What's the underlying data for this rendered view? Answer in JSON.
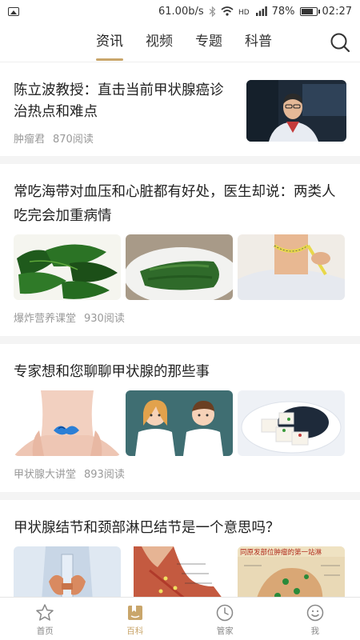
{
  "status_bar": {
    "speed": "61.00b/s",
    "battery": "78%",
    "battery_level": 0.78,
    "time": "02:27"
  },
  "top_tabs": [
    {
      "label": "资讯",
      "active": true
    },
    {
      "label": "视频",
      "active": false
    },
    {
      "label": "专题",
      "active": false
    },
    {
      "label": "科普",
      "active": false
    }
  ],
  "articles": [
    {
      "title": "陈立波教授：直击当前甲状腺癌诊治热点和难点",
      "source": "肿瘤君",
      "reads": "870阅读"
    },
    {
      "title": "常吃海带对血压和心脏都有好处，医生却说：两类人吃完会加重病情",
      "source": "爆炸营养课堂",
      "reads": "930阅读"
    },
    {
      "title": "专家想和您聊聊甲状腺的那些事",
      "source": "甲状腺大讲堂",
      "reads": "893阅读"
    },
    {
      "title": "甲状腺结节和颈部淋巴结节是一个意思吗？",
      "thumb3_text": "同原发部位肿瘤的第一站淋"
    }
  ],
  "bottom_nav": [
    {
      "label": "首页",
      "icon": "star-icon",
      "active": false
    },
    {
      "label": "百科",
      "icon": "book-icon",
      "active": true
    },
    {
      "label": "管家",
      "icon": "clock-icon",
      "active": false
    },
    {
      "label": "我",
      "icon": "smile-icon",
      "active": false
    }
  ],
  "colors": {
    "accent": "#c9a66b"
  }
}
